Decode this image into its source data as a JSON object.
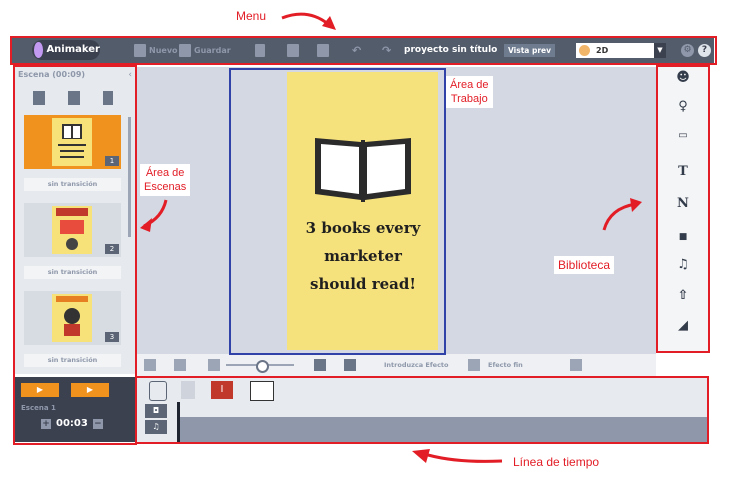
{
  "annotations": {
    "menu": "Menu",
    "area_trabajo_1": "Área de",
    "area_trabajo_2": "Trabajo",
    "area_escenas_1": "Área de",
    "area_escenas_2": "Escenas",
    "biblioteca": "Biblioteca",
    "linea_tiempo": "Línea de tiempo"
  },
  "menubar": {
    "logo": "Animaker",
    "nuevo": "Nuevo",
    "guardar": "Guardar",
    "project_title": "proyecto sin título",
    "vista_previa": "Vista prev",
    "mode_value": "2D",
    "help": "?"
  },
  "scenes": {
    "header": "Escena (00:09)",
    "transition_label": "sin transición",
    "items": [
      {
        "number": "1"
      },
      {
        "number": "2"
      },
      {
        "number": "3"
      }
    ],
    "scene_label": "Escena 1",
    "time": "00:03"
  },
  "poster": {
    "line1": "3 books every",
    "line2": "marketer",
    "line3": "should read!"
  },
  "bottom_toolbar": {
    "intro_effect": "Introduzca Efecto",
    "end_effect": "Efecto fin"
  },
  "library_icons": [
    "character-icon",
    "bulb-icon",
    "image-icon",
    "text-icon",
    "number-icon",
    "video-icon",
    "music-icon",
    "upload-icon",
    "background-icon"
  ],
  "colors": {
    "menubar": "#535c6b",
    "accent": "#f0921e",
    "annotation_red": "#e21d26",
    "workarea_border": "#3042a8",
    "poster_bg": "#f6e27c"
  }
}
